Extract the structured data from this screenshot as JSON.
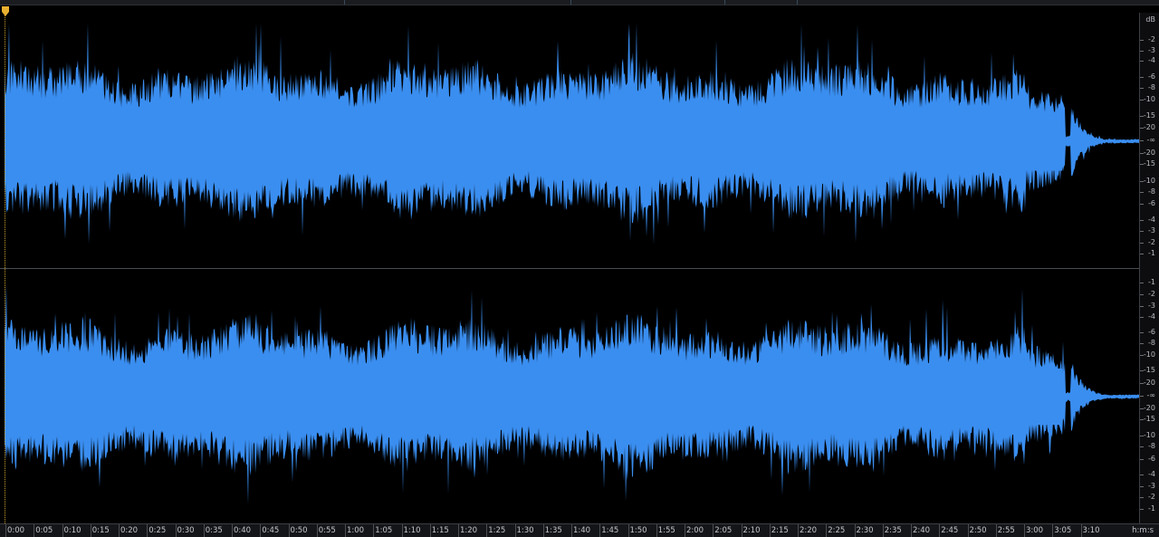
{
  "editor": {
    "waveform_color": "#3a8ef0",
    "background_color": "#000000",
    "playhead_color": "#e8b030",
    "channels": [
      "left",
      "right"
    ]
  },
  "db_scale": {
    "unit_label": "dB",
    "channel_1_labels": [
      "-2",
      "-3",
      "-4",
      "-6",
      "-8",
      "-10",
      "-15",
      "-20",
      "-∞",
      "-20",
      "-15",
      "-10",
      "-8",
      "-6",
      "-4",
      "-3",
      "-2",
      "-1"
    ],
    "channel_2_labels": [
      "-1",
      "-2",
      "-3",
      "-4",
      "-6",
      "-8",
      "-10",
      "-15",
      "-20",
      "-∞",
      "-20",
      "-15",
      "-10",
      "-8",
      "-6",
      "-4",
      "-3",
      "-2",
      "-1"
    ]
  },
  "time_ruler": {
    "labels": [
      "0:00",
      "0:05",
      "0:10",
      "0:15",
      "0:20",
      "0:25",
      "0:30",
      "0:35",
      "0:40",
      "0:45",
      "0:50",
      "0:55",
      "1:00",
      "1:05",
      "1:10",
      "1:15",
      "1:20",
      "1:25",
      "1:30",
      "1:35",
      "1:40",
      "1:45",
      "1:50",
      "1:55",
      "2:00",
      "2:05",
      "2:10",
      "2:15",
      "2:20",
      "2:25",
      "2:30",
      "2:35",
      "2:40",
      "2:45",
      "2:50",
      "2:55",
      "3:00",
      "3:05",
      "3:10"
    ],
    "units_label": "h:m:s"
  }
}
